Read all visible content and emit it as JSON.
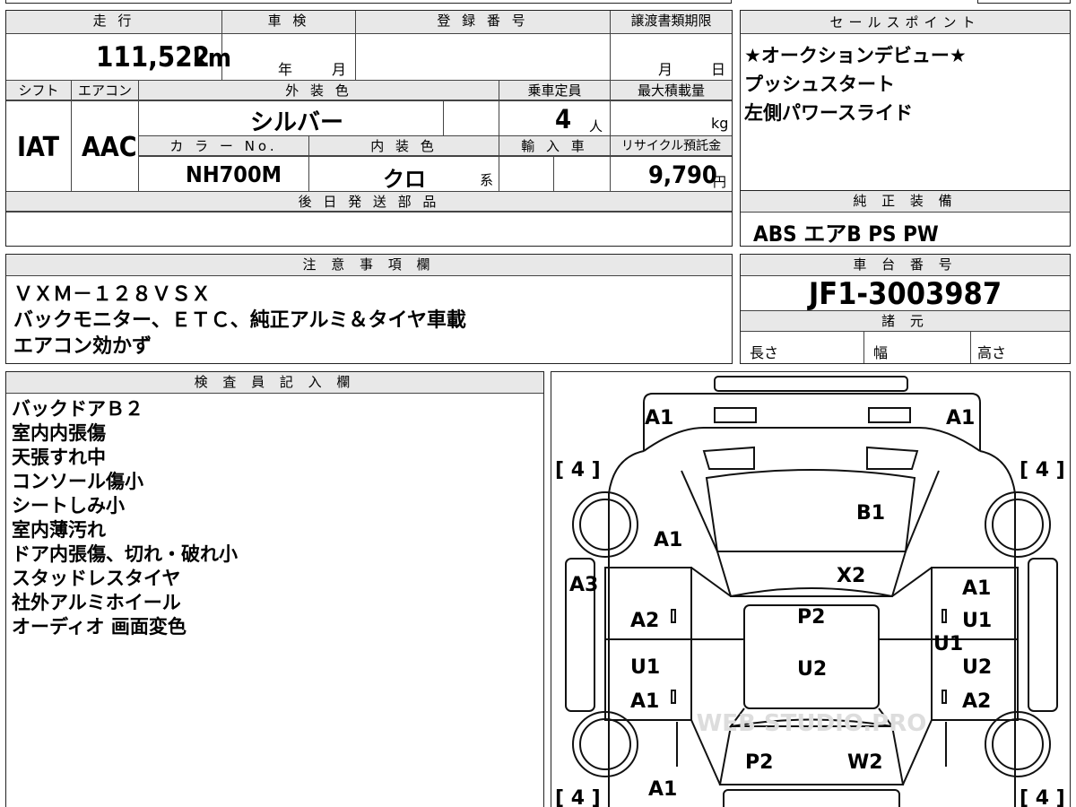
{
  "spec": {
    "mileage_label": "走 行",
    "mileage_value": "111,522",
    "mileage_unit": "km",
    "shaken_label": "車 検",
    "shaken_year": "年",
    "shaken_month": "月",
    "registration_label": "登 録 番 号",
    "transfer_label": "譲渡書類期限",
    "transfer_month": "月",
    "transfer_day": "日",
    "shift_label": "シフト",
    "shift_value": "IAT",
    "aircon_label": "エアコン",
    "aircon_value": "AAC",
    "exterior_label": "外 装 色",
    "exterior_value": "シルバー",
    "capacity_label": "乗車定員",
    "capacity_value": "4",
    "capacity_unit": "人",
    "load_label": "最大積載量",
    "load_unit": "kg",
    "color_no_label": "カ ラ ー No.",
    "color_no_value": "NH700M",
    "interior_label": "内 装 色",
    "interior_value": "クロ",
    "interior_suffix": "系",
    "import_label": "輸 入 車",
    "recycle_label": "リサイクル預託金",
    "recycle_value": "9,790",
    "recycle_unit": "円",
    "later_parts_label": "後 日 発 送 部 品"
  },
  "sales": {
    "label": "セールスポイント",
    "lines": [
      "★オークションデビュー★",
      "プッシュスタート",
      "左側パワースライド"
    ]
  },
  "equipment": {
    "label": "純 正 装 備",
    "value": "ABS エアB PS PW"
  },
  "notes": {
    "label": "注 意 事 項 欄",
    "lines": [
      "ＶＸＭ－１２８ＶＳＸ",
      "バックモニター、ＥＴＣ、純正アルミ＆タイヤ車載",
      "エアコン効かず"
    ]
  },
  "chassis": {
    "label": "車 台 番 号",
    "value": "JF1-3003987"
  },
  "dims": {
    "label": "諸 元",
    "length": "長さ",
    "width": "幅",
    "height": "高さ"
  },
  "inspector": {
    "label": "検 査 員 記 入 欄",
    "lines": [
      "バックドアＢ２",
      "室内内張傷",
      "天張すれ中",
      "コンソール傷小",
      "シートしみ小",
      "室内薄汚れ",
      "ドア内張傷、切れ・破れ小",
      "スタッドレスタイヤ",
      "社外アルミホイール",
      "オーディオ 画面変色"
    ]
  },
  "diagram": {
    "tires": [
      "[ 4 ]",
      "[ 4 ]",
      "[ 4 ]",
      "[ 4 ]"
    ],
    "marks": {
      "top_left": "A1",
      "top_right": "A1",
      "rear_glass": "B1",
      "left_quarter": "A1",
      "roof_edge": "X2",
      "left_side": "A3",
      "right_rear_door": "A1",
      "left_rear_door": "A2",
      "roof": "P2",
      "right_rear_door_2": "U1",
      "right_sill": "U1",
      "left_front_door": "U1",
      "center": "U2",
      "right_front_door": "U2",
      "left_front_door_2": "A1",
      "right_front_door_2": "A2",
      "hood_left": "P2",
      "hood_right": "W2",
      "front_left": "A1"
    },
    "watermark": "WEB STUDIO.PRO"
  }
}
